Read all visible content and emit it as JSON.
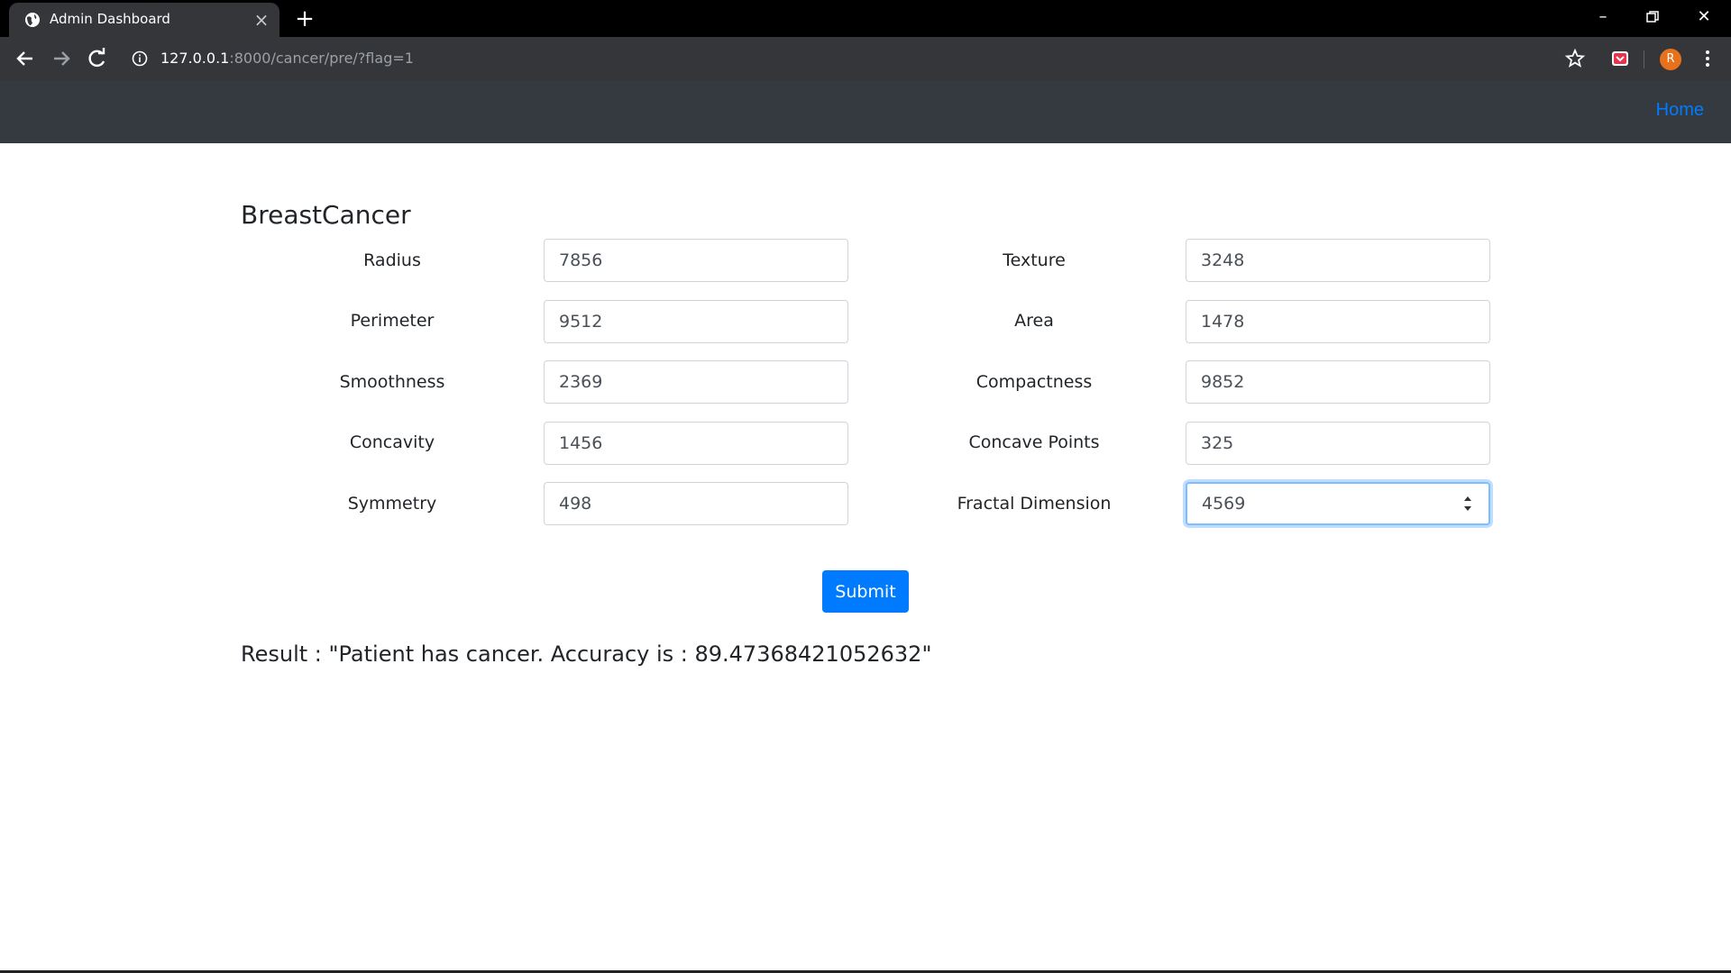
{
  "browser": {
    "tab_title": "Admin Dashboard",
    "url_host": "127.0.0.1",
    "url_path": ":8000/cancer/pre/?flag=1",
    "avatar_letter": "R",
    "accent": "#35363a"
  },
  "navbar": {
    "home_label": "Home",
    "home_color": "#007bff",
    "background": "#343a40"
  },
  "page": {
    "title": "BreastCancer"
  },
  "form": {
    "radius_label": "Radius",
    "radius_value": "7856",
    "texture_label": "Texture",
    "texture_value": "3248",
    "perimeter_label": "Perimeter",
    "perimeter_value": "9512",
    "area_label": "Area",
    "area_value": "1478",
    "smoothness_label": "Smoothness",
    "smoothness_value": "2369",
    "compactness_label": "Compactness",
    "compactness_value": "9852",
    "concavity_label": "Concavity",
    "concavity_value": "1456",
    "concave_points_label": "Concave Points",
    "concave_points_value": "325",
    "symmetry_label": "Symmetry",
    "symmetry_value": "498",
    "fractal_dimension_label": "Fractal Dimension",
    "fractal_dimension_value": "4569",
    "submit_label": "Submit"
  },
  "result": {
    "text": "Result : \"Patient has cancer. Accuracy is : 89.47368421052632\""
  }
}
